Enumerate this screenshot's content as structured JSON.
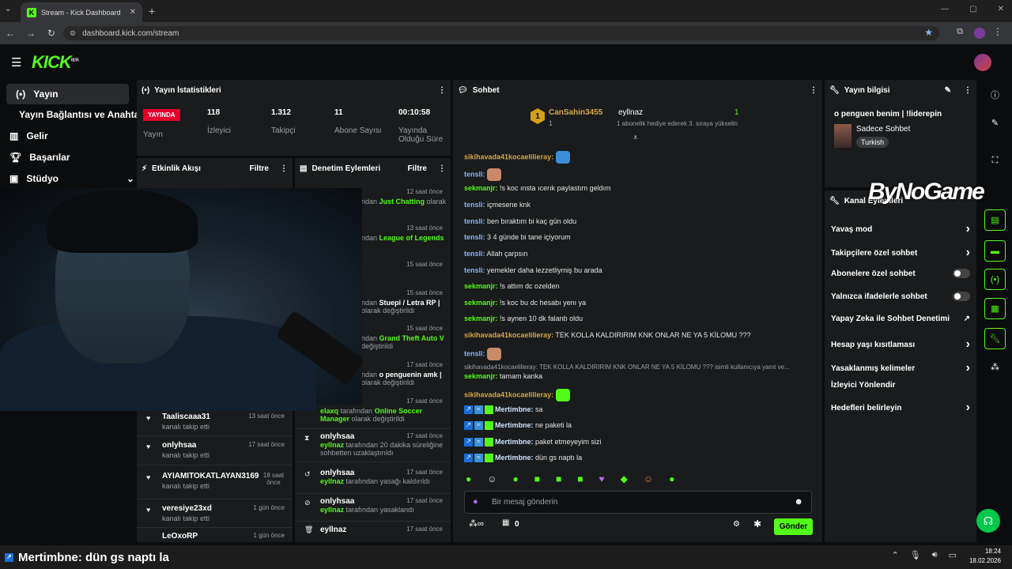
{
  "browser": {
    "tab_title": "Stream - Kick Dashboard",
    "url": "dashboard.kick.com/stream"
  },
  "brand": {
    "logo": "KICK",
    "beta": "BETA"
  },
  "sidebar": {
    "items": [
      {
        "label": "Yayın",
        "icon": "broadcast-icon"
      },
      {
        "label": "Yayın Bağlantısı ve Anahtarı"
      },
      {
        "label": "Gelir",
        "icon": "chart-icon"
      },
      {
        "label": "Başarılar",
        "icon": "trophy-icon"
      },
      {
        "label": "Stüdyo",
        "icon": "studio-icon"
      }
    ]
  },
  "stats": {
    "title": "Yayın İstatistikleri",
    "status": "YAYINDA",
    "status_label": "Yayın",
    "cells": [
      {
        "value": "118",
        "label": "İzleyici"
      },
      {
        "value": "1.312",
        "label": "Takipçi"
      },
      {
        "value": "11",
        "label": "Abone Sayısı"
      },
      {
        "value": "00:10:58",
        "label": "Yayında Olduğu Süre"
      }
    ]
  },
  "events": {
    "title": "Etkinlik Akışı",
    "filter": "Filtre",
    "items": [
      {
        "name": "Taaliscaaa31",
        "desc": "kanalı takip etti",
        "time": "13 saat önce"
      },
      {
        "name": "onlyhsaa",
        "desc": "kanalı takip etti",
        "time": "17 saat önce"
      },
      {
        "name": "AYIAMITOKATLAYAN3169",
        "desc": "kanalı takip etti",
        "time": "18 saat önce"
      },
      {
        "name": "veresiye23xd",
        "desc": "kanalı takip etti",
        "time": "1 gün önce"
      },
      {
        "name": "LeOxoRP",
        "desc": "",
        "time": "1 gün önce"
      }
    ]
  },
  "mod": {
    "title": "Denetim Eylemleri",
    "filter": "Filtre",
    "partial": [
      {
        "time": "12 saat önce",
        "text": "ndan",
        "hl": "Just Chatting",
        "tail": "olarak"
      },
      {
        "time": "13 saat önce",
        "text": "ndan",
        "hl": "League of Legends",
        "tail": ""
      },
      {
        "time": "15 saat önce",
        "text": "",
        "hl": "",
        "tail": ""
      },
      {
        "time": "15 saat önce",
        "text": "ndan",
        "hl": "Stuepi / Letra RP |",
        "tail": "olarak değiştirildi"
      },
      {
        "time": "15 saat önce",
        "text": "ndan",
        "hl": "Grand Theft Auto V",
        "tail": "değiştirildi"
      },
      {
        "time": "17 saat önce",
        "text": "ndan",
        "hl": "o penguenin amk |",
        "tail": "olarak değiştirildi"
      }
    ],
    "items": [
      {
        "name": "",
        "time": "17 saat önce",
        "by": "elaxq",
        "text": "tarafından",
        "hl": "Online Soccer Manager",
        "tail": "olarak değiştirildi"
      },
      {
        "name": "onlyhsaa",
        "time": "17 saat önce",
        "by": "eyllnaz",
        "text": "tarafından 20 dakika süreliğine sohbetten uzaklaştırıldı",
        "hl": "",
        "tail": ""
      },
      {
        "name": "onlyhsaa",
        "time": "17 saat önce",
        "by": "eyllnaz",
        "text": "tarafından yasağı kaldırıldı",
        "hl": "",
        "tail": ""
      },
      {
        "name": "onlyhsaa",
        "time": "17 saat önce",
        "by": "eyllnaz",
        "text": "tarafından yasaklandı",
        "hl": "",
        "tail": ""
      },
      {
        "name": "eyllnaz",
        "time": "17 saat önce",
        "by": "",
        "text": "",
        "hl": "",
        "tail": ""
      }
    ]
  },
  "chat": {
    "title": "Sohbet",
    "pinned_user1": "CanSahin3455",
    "pinned_count1": "1",
    "pinned_user2": "eyllnaz",
    "pinned_count2": "1",
    "pinned_msg": "1 abonelik hediye ederek 3. sıraya yükselin",
    "messages": [
      {
        "user": "sikihavada41kocaelilieray:",
        "text": "",
        "cls": "uy"
      },
      {
        "user": "tensli:",
        "text": "",
        "cls": "ub"
      },
      {
        "user": "sekmanjr:",
        "text": "!s koc ınsta ıcerık paylastım geldım",
        "cls": "ug"
      },
      {
        "user": "tensli:",
        "text": "içmesene knk",
        "cls": "ub"
      },
      {
        "user": "tensli:",
        "text": "ben bıraktım bi kaç gün oldu",
        "cls": "ub"
      },
      {
        "user": "tensli:",
        "text": "3 4 günde bi tane içiyorum",
        "cls": "ub"
      },
      {
        "user": "tensli:",
        "text": "Allah çarpsın",
        "cls": "ub"
      },
      {
        "user": "tensli:",
        "text": "yemekler daha lezzetliymiş bu arada",
        "cls": "ub"
      },
      {
        "user": "sekmanjr:",
        "text": "!s attım dc ozelden",
        "cls": "ug"
      },
      {
        "user": "sekmanjr:",
        "text": "!s koc bu dc hesabı yenı ya",
        "cls": "ug"
      },
      {
        "user": "sekmanjr:",
        "text": "!s aynen 10 dk falanb oldu",
        "cls": "ug"
      },
      {
        "user": "sikihavada41kocaelilieray:",
        "text": "TEK KOLLA KALDIRIRIM KNK ONLAR NE YA 5 KİLOMU ???",
        "cls": "uy"
      },
      {
        "user": "tensli:",
        "text": "",
        "cls": "ub"
      },
      {
        "user": "sekmanjr:",
        "text": "tamam kanka",
        "cls": "ug"
      },
      {
        "user": "sikihavada41kocaelilieray:",
        "text": "",
        "cls": "uy"
      },
      {
        "user": "Mertimbne:",
        "text": "sa",
        "cls": "uw"
      },
      {
        "user": "Mertimbne:",
        "text": "ne paketi la",
        "cls": "uw"
      },
      {
        "user": "Mertimbne:",
        "text": "paket etmeyeyim sizi",
        "cls": "uw"
      },
      {
        "user": "Mertimbne:",
        "text": "dün gs naptı la",
        "cls": "uw"
      }
    ],
    "reply": "sikihavada41kocaelilieray: TEK KOLLA KALDIRIRIM KNK ONLAR NE YA 5 KİLOMU ??? isimli kullanıcıya yanıt ve...",
    "placeholder": "Bir mesaj gönderin",
    "points": "0",
    "send": "Gönder"
  },
  "info": {
    "title": "Yayın bilgisi",
    "stream_title": "o penguen benim | !liderepin",
    "category": "Sadece Sohbet",
    "tag": "Turkish"
  },
  "actions": {
    "title": "Kanal Eylemleri",
    "items": [
      {
        "label": "Yavaş mod",
        "ctl": "arrow"
      },
      {
        "label": "Takipçilere özel sohbet",
        "ctl": "arrow"
      },
      {
        "label": "Abonelere özel sohbet",
        "ctl": "toggle"
      },
      {
        "label": "Yalnızca ifadelerle sohbet",
        "ctl": "toggle"
      },
      {
        "label": "Yapay Zeka ile Sohbet Denetimi",
        "ctl": "ext"
      },
      {
        "label": "Hesap yaşı kısıtlaması",
        "ctl": "arrow"
      },
      {
        "label": "Yasaklanmış kelimeler",
        "ctl": "arrow"
      },
      {
        "label": "İzleyici Yönlendir",
        "ctl": "none"
      },
      {
        "label": "Hedefleri belirleyin",
        "ctl": "arrow"
      }
    ]
  },
  "watermark": "ByNoGame",
  "overlay": {
    "text": "Mertimbne: dün gs naptı la"
  },
  "taskbar": {
    "time": "18:24",
    "date": "18.02.2026"
  }
}
